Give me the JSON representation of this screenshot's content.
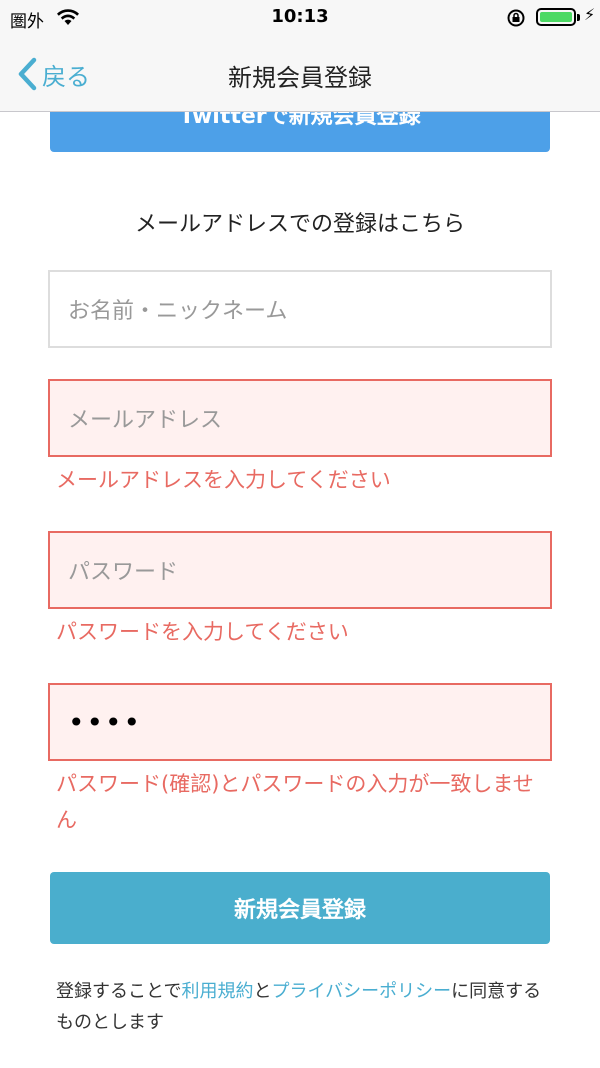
{
  "status_bar": {
    "carrier": "圏外",
    "time": "10:13"
  },
  "nav": {
    "back_label": "戻る",
    "title": "新規会員登録"
  },
  "twitter_button_label": "Twitterで新規会員登録",
  "section_heading": "メールアドレスでの登録はこちら",
  "form": {
    "name_placeholder": "お名前・ニックネーム",
    "email_placeholder": "メールアドレス",
    "email_error": "メールアドレスを入力してください",
    "password_placeholder": "パスワード",
    "password_error": "パスワードを入力してください",
    "password_confirm_value": "••••",
    "password_confirm_error": "パスワード(確認)とパスワードの入力が一致しません"
  },
  "submit_label": "新規会員登録",
  "terms": {
    "prefix": "登録することで",
    "link1": "利用規約",
    "middle": "と",
    "link2": "プライバシーポリシー",
    "suffix": "に同意するものとします"
  },
  "colors": {
    "accent": "#4aaecd",
    "twitter": "#4da0e8",
    "error": "#e86a62"
  }
}
